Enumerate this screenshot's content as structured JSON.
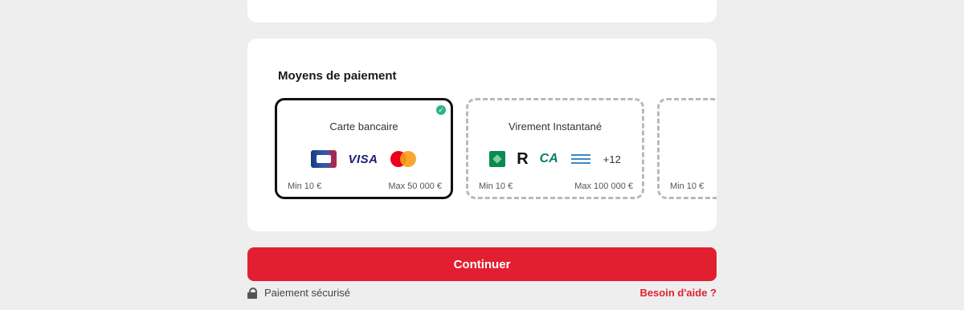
{
  "payment": {
    "section_title": "Moyens de paiement",
    "methods": [
      {
        "title": "Carte bancaire",
        "selected": true,
        "min": "Min 10 €",
        "max": "Max 50 000 €",
        "icons": [
          "cb-card-icon",
          "visa-icon",
          "mastercard-icon"
        ],
        "visa_text": "VISA"
      },
      {
        "title": "Virement Instantané",
        "selected": false,
        "min": "Min 10 €",
        "max": "Max 100 000 €",
        "icons": [
          "bnp-bank-icon",
          "revolut-icon",
          "credit-agricole-icon",
          "banque-postale-icon"
        ],
        "revolut_text": "R",
        "ca_text": "CA",
        "more": "+12"
      },
      {
        "title": "",
        "selected": false,
        "min": "Min 10 €"
      }
    ]
  },
  "actions": {
    "continue_label": "Continuer",
    "secure_label": "Paiement sécurisé",
    "help_label": "Besoin d'aide ?"
  },
  "colors": {
    "accent": "#e21f30",
    "selected_check": "#2bb38a",
    "background": "#eeeeee"
  }
}
